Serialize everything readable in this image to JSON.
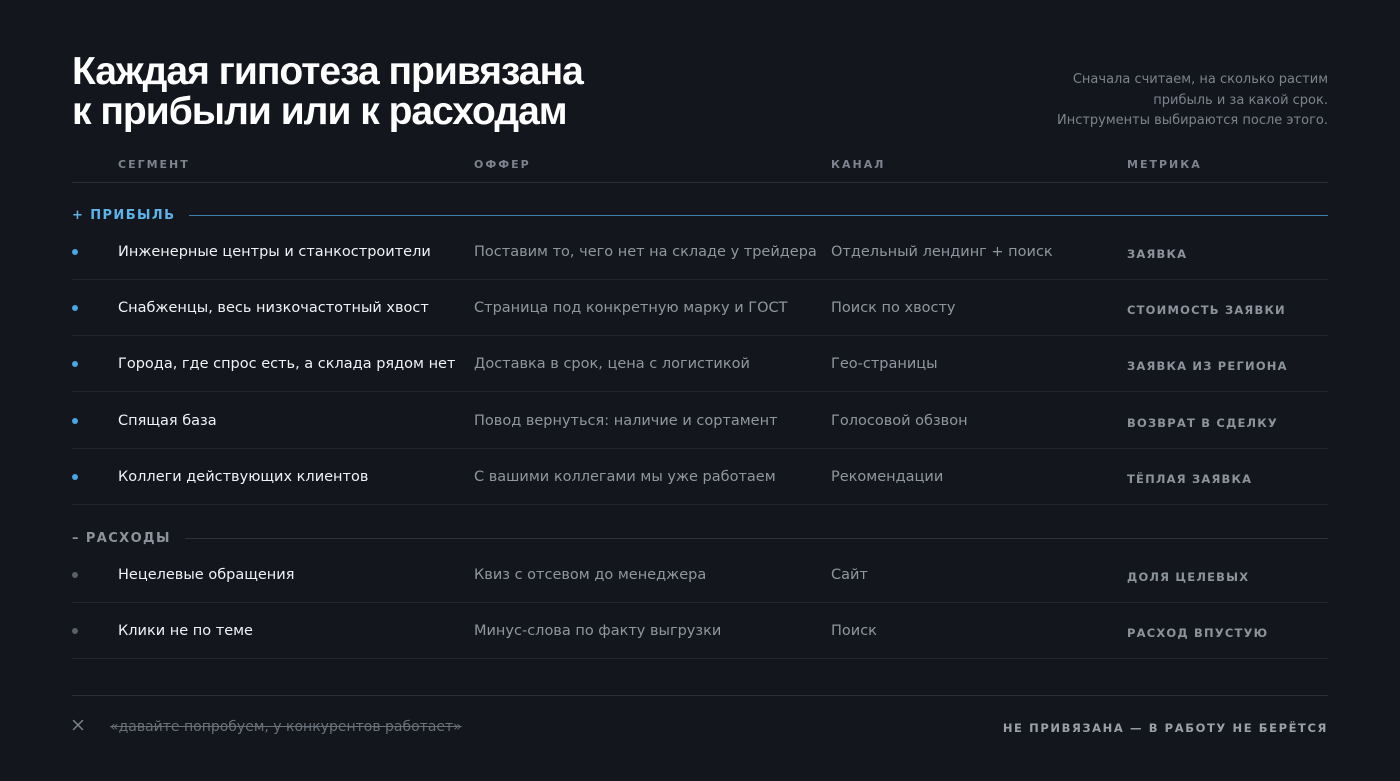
{
  "header": {
    "title_line1": "Каждая гипотеза привязана",
    "title_line2": "к прибыли или к расходам",
    "subtitle_line1": "Сначала считаем, на сколько растим",
    "subtitle_line2": "прибыль и за какой срок.",
    "subtitle_line3": "Инструменты выбираются после этого."
  },
  "columns": {
    "segment": "СЕГМЕНТ",
    "offer": "ОФФЕР",
    "channel": "КАНАЛ",
    "metric": "МЕТРИКА"
  },
  "groups": {
    "profit": {
      "label": "+ ПРИБЫЛЬ",
      "rows": [
        {
          "segment": "Инженерные центры и станкостроители",
          "offer": "Поставим то, чего нет на складе у трейдера",
          "channel": "Отдельный лендинг + поиск",
          "metric": "ЗАЯВКА"
        },
        {
          "segment": "Снабженцы, весь низкочастотный хвост",
          "offer": "Страница под конкретную марку и ГОСТ",
          "channel": "Поиск по хвосту",
          "metric": "СТОИМОСТЬ ЗАЯВКИ"
        },
        {
          "segment": "Города, где спрос есть, а склада рядом нет",
          "offer": "Доставка в срок, цена с логистикой",
          "channel": "Гео-страницы",
          "metric": "ЗАЯВКА ИЗ РЕГИОНА"
        },
        {
          "segment": "Спящая база",
          "offer": "Повод вернуться: наличие и сортамент",
          "channel": "Голосовой обзвон",
          "metric": "ВОЗВРАТ В СДЕЛКУ"
        },
        {
          "segment": "Коллеги действующих клиентов",
          "offer": "С вашими коллегами мы уже работаем",
          "channel": "Рекомендации",
          "metric": "ТЁПЛАЯ ЗАЯВКА"
        }
      ]
    },
    "cost": {
      "label": "– РАСХОДЫ",
      "rows": [
        {
          "segment": "Нецелевые обращения",
          "offer": "Квиз с отсевом до менеджера",
          "channel": "Сайт",
          "metric": "ДОЛЯ ЦЕЛЕВЫХ"
        },
        {
          "segment": "Клики не по теме",
          "offer": "Минус-слова по факту выгрузки",
          "channel": "Поиск",
          "metric": "РАСХОД ВПУСТУЮ"
        }
      ]
    }
  },
  "footer": {
    "icon": "close-icon",
    "rejected_quote": "«давайте попробуем, у конкурентов работает»",
    "note": "НЕ ПРИВЯЗАНА — В РАБОТУ НЕ БЕРЁТСЯ"
  },
  "colors": {
    "background": "#13161c",
    "accent": "#4aa6e0",
    "muted": "#8d939d"
  }
}
